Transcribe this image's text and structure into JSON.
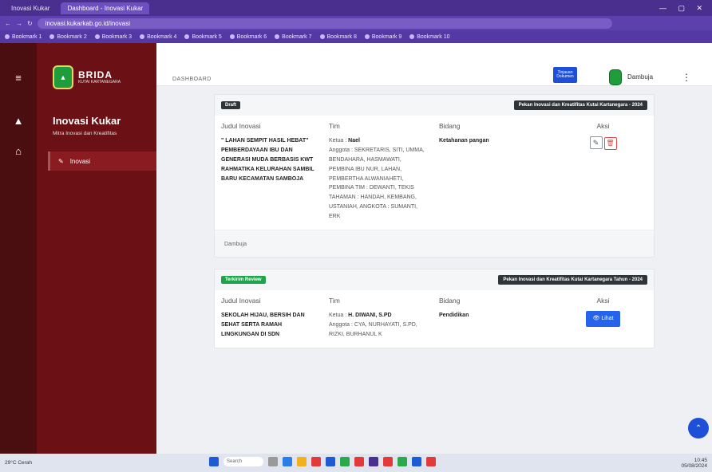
{
  "browser": {
    "tabs": [
      {
        "label": "Inovasi Kukar"
      },
      {
        "label": "Dashboard - Inovasi Kukar"
      }
    ],
    "url": "inovasi.kukarkab.go.id/inovasi",
    "bookmarks": [
      "Bookmark 1",
      "Bookmark 2",
      "Bookmark 3",
      "Bookmark 4",
      "Bookmark 5",
      "Bookmark 6",
      "Bookmark 7",
      "Bookmark 8",
      "Bookmark 9",
      "Bookmark 10"
    ]
  },
  "sidebar": {
    "brand_name": "BRIDA",
    "brand_sub": "KUTAI KARTANEGARA",
    "app_title": "Inovasi Kukar",
    "app_subtitle": "Mitra Inovasi dan Kreatifitas",
    "menu_item": "Inovasi"
  },
  "topbar": {
    "breadcrumb": "DASHBOARD",
    "notification_line1": "Tinjauan",
    "notification_line2": "Dokumen",
    "username": "Dambuja"
  },
  "cards": [
    {
      "badge": "Draft",
      "badge_color": "#2f3439",
      "period": "Pekan Inovasi dan Kreatifitas Kutai Kartanegara - 2024",
      "headers": {
        "title": "Judul Inovasi",
        "team": "Tim",
        "field": "Bidang",
        "action": "Aksi"
      },
      "title": "\" LAHAN SEMPIT HASIL HEBAT\" PEMBERDAYAAN IBU DAN GENERASI MUDA BERBASIS KWT RAHMATIKA KELURAHAN SAMBIL BARU KECAMATAN SAMBOJA",
      "team_leader_label": "Ketua :",
      "team_leader": "Nael",
      "team_members_label": "Anggota :",
      "team_members": "SEKRETARIS, SITI, UMMA, BENDAHARA, HASMAWATI, PEMBINA IBU NUR, LAHAN, PEMBERTHA ALWANIAHETI, PEMBINA TIM : DEWANTI, TEKIS TAHAMAN : HANDAH, KEMBANG, USTANIAH, ANGKOTA : SUMANTI, ERK",
      "field": "Ketahanan pangan",
      "footer": "Dambuja"
    },
    {
      "badge": "Terkirim Review",
      "badge_color": "#1fa44a",
      "period": "Pekan Inovasi dan Kreatifitas Kutai Kartanegara Tahun - 2024",
      "headers": {
        "title": "Judul Inovasi",
        "team": "Tim",
        "field": "Bidang",
        "action": "Aksi"
      },
      "title": "SEKOLAH HIJAU, BERSIH DAN SEHAT SERTA RAMAH LINGKUNGAN DI SDN",
      "team_leader_label": "Ketua :",
      "team_leader": "H. DIWANI, S.PD",
      "team_members_label": "Anggota :",
      "team_members": "CYA, NURHAYATI, S.PD, RIZKI, BURHANUL K",
      "field": "Pendidikan",
      "action_label": "Lihat"
    }
  ],
  "taskbar": {
    "weather": "29°C Cerah",
    "search_placeholder": "Search",
    "time": "10:45",
    "date": "05/08/2024"
  },
  "colors": {
    "sidebar": "#6b1015",
    "rail": "#4a0d10",
    "browser": "#4a2f8f",
    "primary": "#2563eb"
  }
}
